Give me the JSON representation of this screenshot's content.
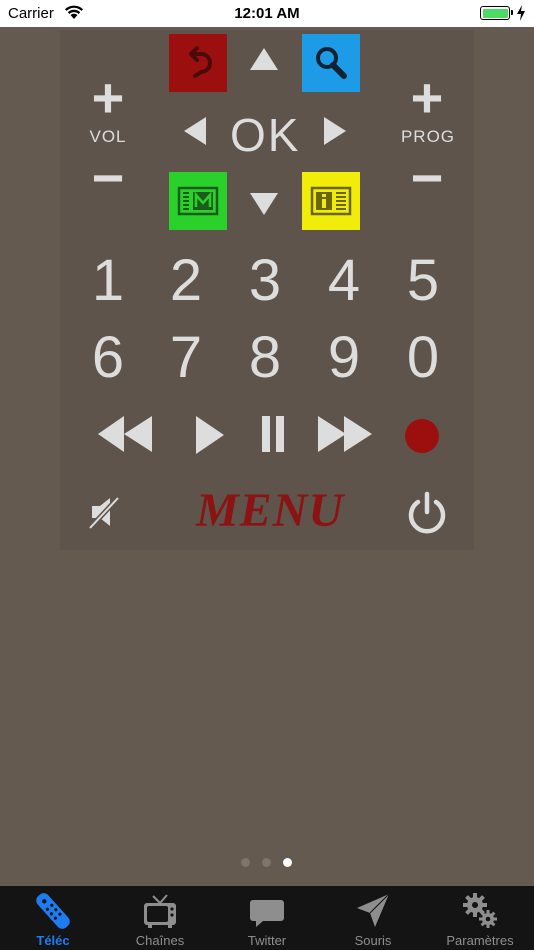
{
  "statusbar": {
    "carrier": "Carrier",
    "time": "12:01 AM"
  },
  "remote": {
    "vol_label": "VOL",
    "prog_label": "PROG",
    "plus": "+",
    "minus": "−",
    "ok_label": "OK",
    "digits_row1": [
      "1",
      "2",
      "3",
      "4",
      "5"
    ],
    "digits_row2": [
      "6",
      "7",
      "8",
      "9",
      "0"
    ],
    "menu_label": "MENU",
    "colors": {
      "back": "#9b0f0f",
      "search": "#1e9be6",
      "guide": "#2bd12b",
      "info": "#f2ec0a",
      "record": "#9b0f0f",
      "menu": "#8a1414"
    }
  },
  "pager": {
    "count": 3,
    "active": 2
  },
  "tabbar": {
    "tabs": [
      {
        "label": "Téléc",
        "icon": "remote-icon"
      },
      {
        "label": "Chaînes",
        "icon": "tv-icon"
      },
      {
        "label": "Twitter",
        "icon": "chat-bubble-icon"
      },
      {
        "label": "Souris",
        "icon": "pointer-arrow-icon"
      },
      {
        "label": "Paramètres",
        "icon": "gears-icon"
      }
    ]
  }
}
